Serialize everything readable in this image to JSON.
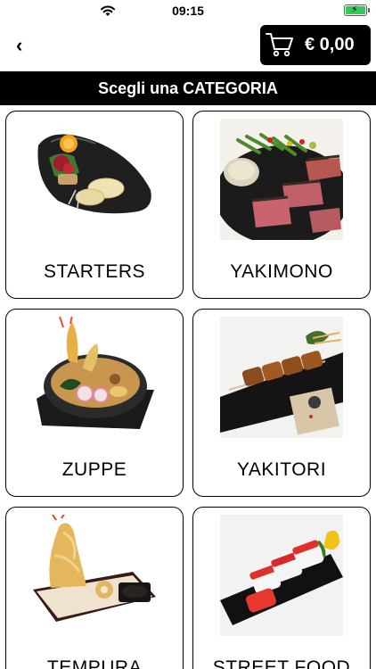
{
  "status_bar": {
    "time": "09:15"
  },
  "nav": {
    "back_symbol": "‹",
    "cart_total": "€ 0,00",
    "cart_icon": "cart-icon"
  },
  "header": {
    "title": "Scegli una CATEGORIA"
  },
  "categories": [
    {
      "label": "STARTERS"
    },
    {
      "label": "YAKIMONO"
    },
    {
      "label": "ZUPPE"
    },
    {
      "label": "YAKITORI"
    },
    {
      "label": "TEMPURA"
    },
    {
      "label": "STREET FOOD"
    }
  ],
  "colors": {
    "bar": "#000000",
    "background": "#ffffff",
    "battery": "#34c759"
  }
}
